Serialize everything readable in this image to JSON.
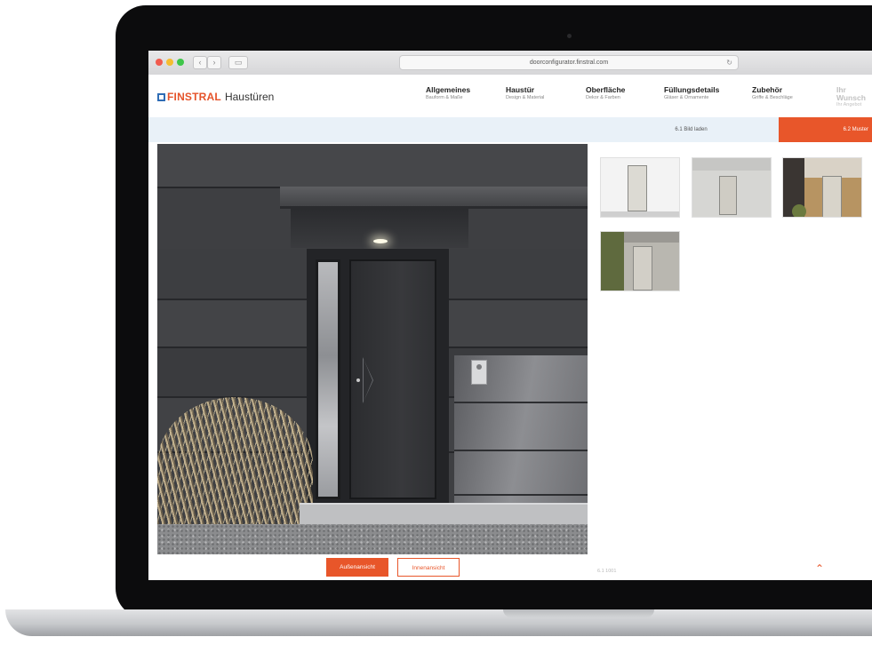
{
  "browser": {
    "url": "doorconfigurator.finstral.com"
  },
  "header": {
    "brand": "FINSTRAL",
    "product": "Haustüren"
  },
  "steps": [
    {
      "title": "Allgemeines",
      "subtitle": "Bauform & Maße"
    },
    {
      "title": "Haustür",
      "subtitle": "Design & Material"
    },
    {
      "title": "Oberfläche",
      "subtitle": "Dekor & Farben"
    },
    {
      "title": "Füllungsdetails",
      "subtitle": "Gläser & Ornamente"
    },
    {
      "title": "Zubehör",
      "subtitle": "Griffe & Beschläge"
    },
    {
      "title": "Ihr Wunsch",
      "subtitle": "Ihr Angebot"
    }
  ],
  "subtabs": {
    "tab_a": "6.1 Bild laden",
    "tab_b": "6.2 Muster"
  },
  "view_buttons": {
    "outside": "Außenansicht",
    "inside": "Innenansicht"
  },
  "bottom_note": "6.1  1001",
  "colors": {
    "accent": "#e8562a",
    "brand_blue": "#2f6db5",
    "subtab_bg": "#e9f1f8"
  },
  "icons": {
    "scroll_up": "chevron-up-icon"
  }
}
